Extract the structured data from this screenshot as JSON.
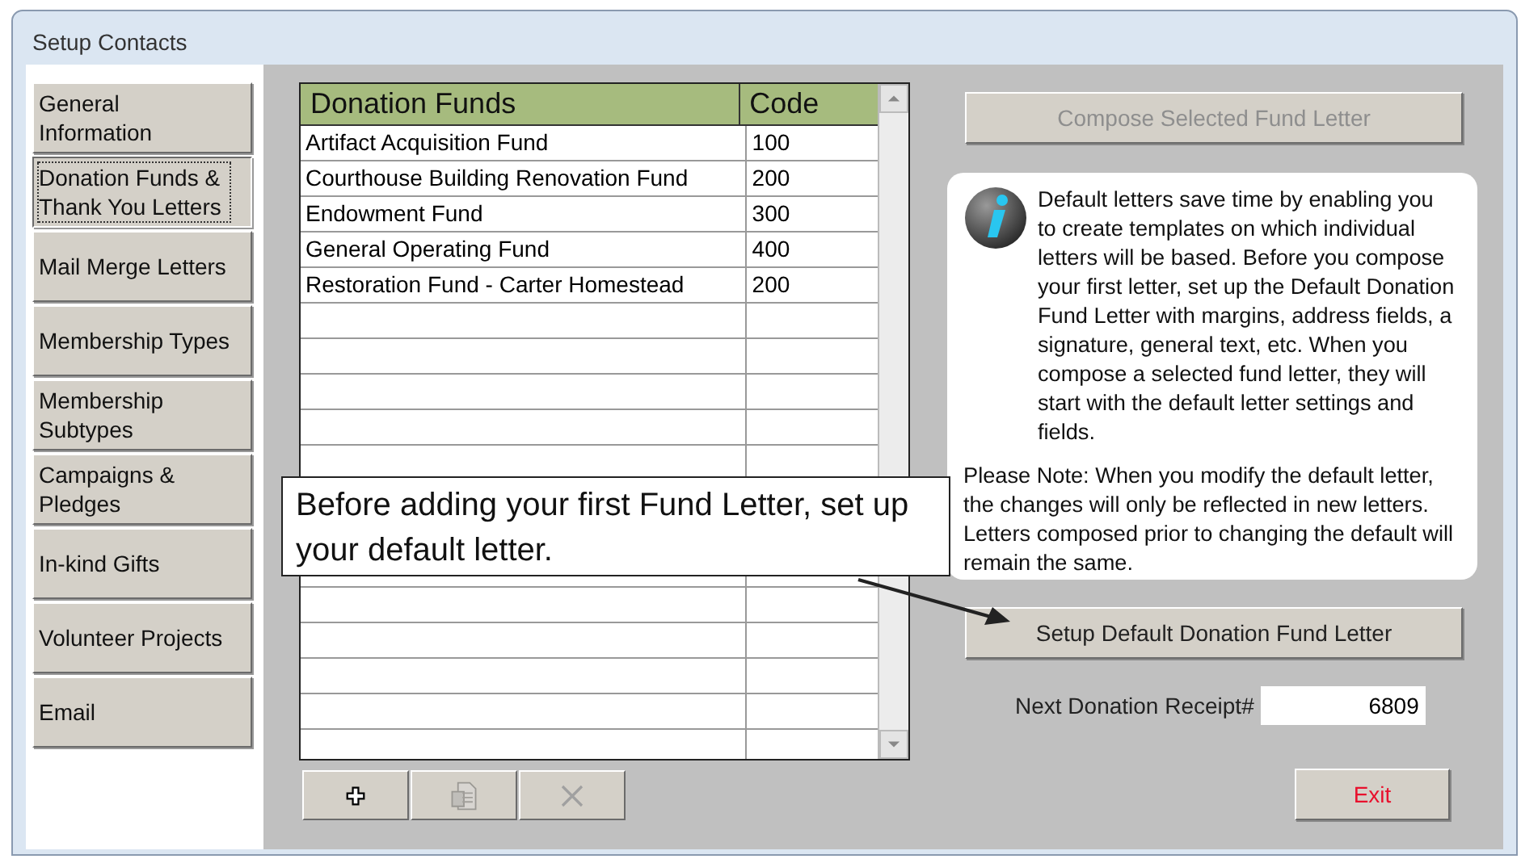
{
  "window": {
    "title": "Setup Contacts"
  },
  "sidebar": {
    "items": [
      {
        "label": "General Information",
        "selected": false
      },
      {
        "label": "Donation Funds & Thank You Letters",
        "selected": true
      },
      {
        "label": "Mail Merge Letters",
        "selected": false
      },
      {
        "label": "Membership Types",
        "selected": false
      },
      {
        "label": "Membership Subtypes",
        "selected": false
      },
      {
        "label": "Campaigns & Pledges",
        "selected": false
      },
      {
        "label": "In-kind Gifts",
        "selected": false
      },
      {
        "label": "Volunteer Projects",
        "selected": false
      },
      {
        "label": "Email",
        "selected": false
      }
    ]
  },
  "table": {
    "columns": [
      "Donation Funds",
      "Code"
    ],
    "rows": [
      {
        "name": "Artifact Acquisition Fund",
        "code": "100"
      },
      {
        "name": "Courthouse Building Renovation Fund",
        "code": "200"
      },
      {
        "name": "Endowment Fund",
        "code": "300"
      },
      {
        "name": "General Operating Fund",
        "code": "400"
      },
      {
        "name": "Restoration Fund - Carter Homestead",
        "code": "200"
      }
    ]
  },
  "toolbar": [
    {
      "kind": "add",
      "disabled": false
    },
    {
      "kind": "copy",
      "disabled": true
    },
    {
      "kind": "delete",
      "disabled": true
    }
  ],
  "callout": {
    "text": "Before adding your first Fund Letter, set up your default letter."
  },
  "compose_button": {
    "label": "Compose Selected Fund Letter",
    "disabled": true
  },
  "info": {
    "paragraphs": [
      "Default letters save time by enabling you to create templates on which individual letters will be based. Before you compose your first letter, set up the Default Donation Fund Letter with margins, address fields, a signature, general text, etc. When you compose a selected fund letter, they will start with the default letter settings and fields.",
      "Please Note:  When you modify the default letter, the changes will only be reflected in new letters. Letters composed prior to changing the default will remain the same."
    ]
  },
  "setup_button": {
    "label": "Setup Default Donation Fund Letter",
    "disabled": false
  },
  "receipt": {
    "label": "Next Donation Receipt#",
    "value": "6809"
  },
  "exit_button": {
    "label": "Exit"
  }
}
